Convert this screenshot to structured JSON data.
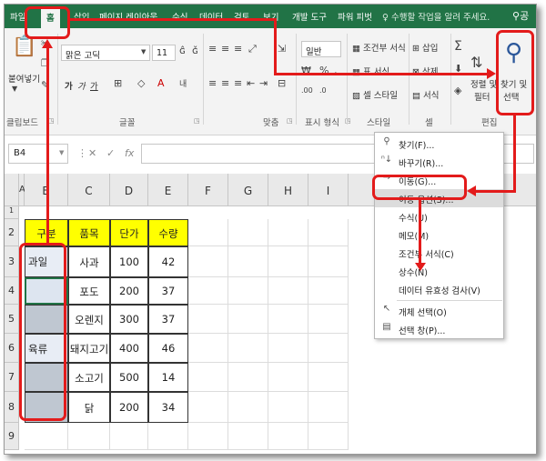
{
  "tabs": [
    "파일",
    "홈",
    "삽입",
    "페이지 레이아웃",
    "수식",
    "데이터",
    "검토",
    "보기",
    "개발 도구",
    "파워 피벗"
  ],
  "active_tab": "홈",
  "tell_me": "수행할 작업을 알려 주세요.",
  "share": "공",
  "ribbon": {
    "paste": "붙여넣기",
    "clipboard": "클립보드",
    "font_name": "맑은 고딕",
    "font_size": "11",
    "font": "글꼴",
    "align": "맞춤",
    "number_format": "일반",
    "number": "표시 형식",
    "cond_format": "조건부 서식",
    "table_format": "표 서식",
    "cell_style": "셀 스타일",
    "styles": "스타일",
    "insert": "삽입",
    "delete": "삭제",
    "format": "서식",
    "cells": "셀",
    "sort_filter_1": "정렬 및",
    "sort_filter_2": "필터",
    "find_select_1": "찾기 및",
    "find_select_2": "선택",
    "editing": "편집",
    "bold": "가",
    "italic": "가",
    "underline": "가"
  },
  "formula_bar": {
    "name_box": "B4",
    "cancel": "✕",
    "enter": "✓",
    "fx": "fx",
    "content": ""
  },
  "columns": [
    "A",
    "B",
    "C",
    "D",
    "E",
    "F",
    "G",
    "H",
    "I"
  ],
  "rows": [
    "1",
    "2",
    "3",
    "4",
    "5",
    "6",
    "7",
    "8",
    "9"
  ],
  "table": {
    "headers": [
      "구분",
      "품목",
      "단가",
      "수량"
    ],
    "category": [
      "과일",
      "",
      "",
      "육류",
      "",
      ""
    ],
    "items": [
      "사과",
      "포도",
      "오렌지",
      "돼지고기",
      "소고기",
      "닭"
    ],
    "prices": [
      "100",
      "200",
      "300",
      "400",
      "500",
      "200"
    ],
    "quantities": [
      "42",
      "37",
      "37",
      "46",
      "14",
      "34"
    ]
  },
  "menu": {
    "find": "찾기(F)...",
    "replace": "바꾸기(R)...",
    "goto": "이동(G)...",
    "goto_special": "이동 옵션(S)...",
    "formulas": "수식(U)",
    "comments": "메모(M)",
    "cond_formatting": "조건부 서식(C)",
    "constants": "상수(N)",
    "data_validation": "데이터 유효성 검사(V)",
    "select_objects": "개체 선택(O)",
    "selection_pane": "선택 창(P)..."
  },
  "colors": {
    "excel_green": "#217346",
    "annotation_red": "#e31b1b",
    "header_yellow": "#ffff00",
    "selected_gray": "#bfc7d1"
  }
}
